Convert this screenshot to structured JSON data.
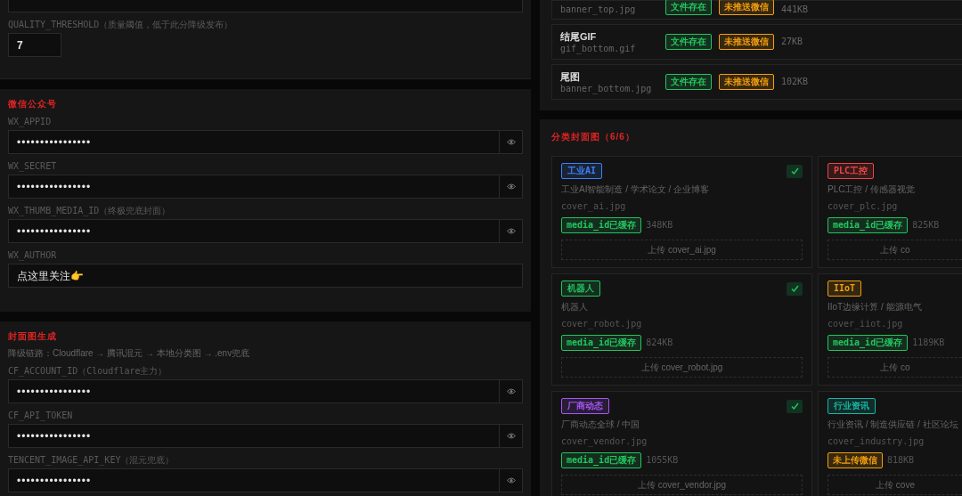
{
  "left_panel": {
    "quality_field": {
      "label": "QUALITY_THRESHOLD（质量阈值，低于此分降级发布）",
      "value": "7"
    },
    "sections": [
      {
        "title": "微信公众号",
        "fields": [
          {
            "label": "WX_APPID",
            "value": "••••••••••••••••",
            "masked": true
          },
          {
            "label": "WX_SECRET",
            "value": "••••••••••••••••",
            "masked": true
          },
          {
            "label": "WX_THUMB_MEDIA_ID（终极兜底封面）",
            "value": "••••••••••••••••",
            "masked": true
          },
          {
            "label": "WX_AUTHOR",
            "value": "点这里关注👉",
            "masked": false
          }
        ]
      },
      {
        "title": "封面图生成",
        "note": "降级链路：Cloudflare → 腾讯混元 → 本地分类图 → .env兜底",
        "fields": [
          {
            "label": "CF_ACCOUNT_ID（Cloudflare主力）",
            "value": "••••••••••••••••",
            "masked": true
          },
          {
            "label": "CF_API_TOKEN",
            "value": "••••••••••••••••",
            "masked": true
          },
          {
            "label": "TENCENT_IMAGE_API_KEY（混元兜底）",
            "value": "••••••••••••••••",
            "masked": true
          }
        ]
      }
    ]
  },
  "right_panel": {
    "asset_rows": [
      {
        "file": "banner_top.jpg",
        "badges": [
          {
            "text": "文件存在",
            "color": "#22c55e"
          },
          {
            "text": "未推送微信",
            "color": "#f59e0b"
          }
        ],
        "size": "441KB"
      },
      {
        "name": "结尾GIF",
        "file": "gif_bottom.gif",
        "badges": [
          {
            "text": "文件存在",
            "color": "#22c55e"
          },
          {
            "text": "未推送微信",
            "color": "#f59e0b"
          }
        ],
        "size": "27KB"
      },
      {
        "name": "尾图",
        "file": "banner_bottom.jpg",
        "badges": [
          {
            "text": "文件存在",
            "color": "#22c55e"
          },
          {
            "text": "未推送微信",
            "color": "#f59e0b"
          }
        ],
        "size": "102KB"
      }
    ],
    "covers": {
      "title": "分类封面图（6/6）",
      "cards": [
        {
          "tag": "工业AI",
          "color": "#3b82f6",
          "checked": true,
          "desc": "工业AI智能制造 / 学术论文 / 企业博客",
          "file": "cover_ai.jpg",
          "status": {
            "text": "media_id已缓存",
            "color": "#22c55e"
          },
          "size": "348KB",
          "upload": "上传 cover_ai.jpg"
        },
        {
          "tag": "PLC工控",
          "color": "#ef4444",
          "desc": "PLC工控 / 传感器视觉",
          "file": "cover_plc.jpg",
          "status": {
            "text": "media_id已缓存",
            "color": "#22c55e"
          },
          "size": "825KB",
          "upload": "上传 co"
        },
        {
          "tag": "机器人",
          "color": "#22c55e",
          "checked": true,
          "desc": "机器人",
          "file": "cover_robot.jpg",
          "status": {
            "text": "media_id已缓存",
            "color": "#22c55e"
          },
          "size": "824KB",
          "upload": "上传 cover_robot.jpg"
        },
        {
          "tag": "IIoT",
          "color": "#f59e0b",
          "desc": "IIoT边缘计算 / 能源电气",
          "file": "cover_iiot.jpg",
          "status": {
            "text": "media_id已缓存",
            "color": "#22c55e"
          },
          "size": "1189KB",
          "upload": "上传 co"
        },
        {
          "tag": "厂商动态",
          "color": "#a855f7",
          "checked": true,
          "desc": "厂商动态全球 / 中国",
          "file": "cover_vendor.jpg",
          "status": {
            "text": "media_id已缓存",
            "color": "#22c55e"
          },
          "size": "1055KB",
          "upload": "上传 cover_vendor.jpg"
        },
        {
          "tag": "行业资讯",
          "color": "#14b8a6",
          "desc": "行业资讯 / 制造供应链 / 社区论坛",
          "file": "cover_industry.jpg",
          "status": {
            "text": "未上传微信",
            "color": "#f59e0b"
          },
          "size": "818KB",
          "upload": "上传 cove"
        }
      ]
    }
  }
}
